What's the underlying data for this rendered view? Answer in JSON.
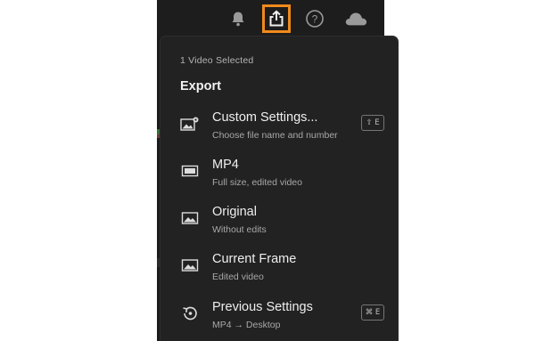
{
  "toolbar": {
    "icons": [
      "bell-icon",
      "share-export-icon",
      "help-icon",
      "cloud-icon"
    ],
    "active_icon": "share-export-icon",
    "highlight_color": "#f08a1c"
  },
  "export_menu": {
    "selection_count": "1 Video Selected",
    "title": "Export",
    "items": [
      {
        "label": "Custom Settings...",
        "sub": "Choose file name and number",
        "shortcut": "⇧ E",
        "icon": "image-settings-icon"
      },
      {
        "label": "MP4",
        "sub": "Full size, edited video",
        "icon": "video-icon"
      },
      {
        "label": "Original",
        "sub": "Without edits",
        "icon": "image-icon"
      },
      {
        "label": "Current Frame",
        "sub": "Edited video",
        "icon": "image-icon"
      },
      {
        "label": "Previous Settings",
        "sub": "MP4 → Desktop",
        "shortcut": "⌘ E",
        "icon": "history-icon"
      }
    ]
  }
}
